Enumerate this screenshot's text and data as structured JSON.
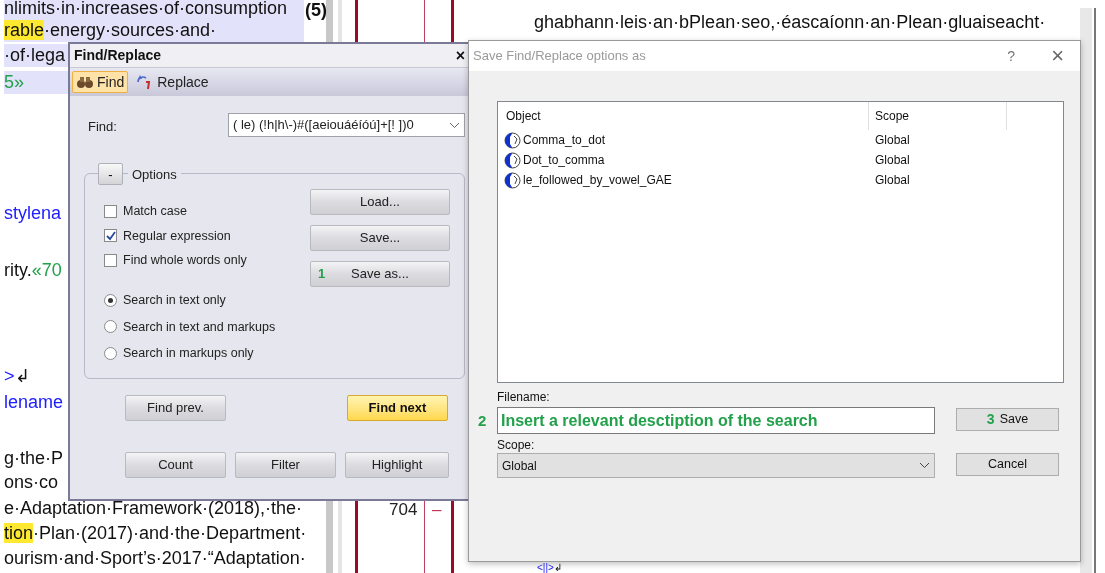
{
  "document_left": {
    "heading_fragment": "(5)",
    "lines": [
      {
        "selected": true,
        "segments": [
          {
            "text": "nlimits·in·increases·of·consumption",
            "kind": "text",
            "highlighted": false
          }
        ]
      },
      {
        "selected": true,
        "segments": [
          {
            "text": "rable",
            "kind": "text",
            "highlighted": true
          },
          {
            "text": "·energy·sources·and·",
            "kind": "text",
            "highlighted": false
          }
        ]
      },
      {
        "selected": true,
        "segments": [
          {
            "text": "·of·lega",
            "kind": "text",
            "highlighted": false
          }
        ]
      },
      {
        "selected": true,
        "segments": [
          {
            "text": "5»",
            "kind": "marker",
            "highlighted": false
          }
        ]
      },
      {
        "selected": false,
        "segments": [
          {
            "text": "stylena",
            "kind": "markup",
            "highlighted": false
          }
        ]
      },
      {
        "selected": false,
        "segments": [
          {
            "text": "rity.",
            "kind": "text",
            "highlighted": false
          },
          {
            "text": "«70",
            "kind": "marker",
            "highlighted": false
          }
        ]
      },
      {
        "selected": false,
        "segments": [
          {
            "text": ">",
            "kind": "markup",
            "highlighted": false
          },
          {
            "text": "↲",
            "kind": "text",
            "highlighted": false
          }
        ]
      },
      {
        "selected": false,
        "segments": [
          {
            "text": "lename",
            "kind": "markup",
            "highlighted": false
          }
        ]
      },
      {
        "selected": false,
        "segments": [
          {
            "text": "g·the·P",
            "kind": "text",
            "highlighted": false
          }
        ]
      },
      {
        "selected": false,
        "segments": [
          {
            "text": "ons·co",
            "kind": "text",
            "highlighted": false
          }
        ]
      },
      {
        "selected": false,
        "segments": [
          {
            "text": "e·Adaptation·Framework·(2018),·the·",
            "kind": "text",
            "highlighted": false
          }
        ]
      },
      {
        "selected": false,
        "segments": [
          {
            "text": "tion",
            "kind": "text",
            "highlighted": true
          },
          {
            "text": "·Plan·(2017)·and·the·Department·",
            "kind": "text",
            "highlighted": false
          }
        ]
      },
      {
        "selected": false,
        "segments": [
          {
            "text": "ourism·and·Sport’s·2017·“Adaptation·",
            "kind": "text",
            "highlighted": false
          }
        ]
      }
    ]
  },
  "margin": {
    "line_number": "704",
    "change_mark": "–"
  },
  "document_right": {
    "lines": [
      {
        "segments": [
          {
            "text": "ghabhann·leis·an·bPlean·seo,·éascaíonn·an·Plean·gluaiseacht·",
            "kind": "text"
          }
        ]
      },
      {
        "segments": [
          {
            "text": "<||>",
            "kind": "markup"
          },
          {
            "text": "↲",
            "kind": "text"
          }
        ]
      }
    ]
  },
  "find_dialog": {
    "title": "Find/Replace",
    "close": "×",
    "tabs": [
      {
        "label": "Find",
        "selected": true,
        "kind": "find"
      },
      {
        "label": "Replace",
        "selected": false,
        "kind": "replace"
      }
    ],
    "find_label": "Find:",
    "find_value": "( le) (!h|h\\-)#([aeiouáéíóú]+[! ])0",
    "options": {
      "toggle": "-",
      "label": "Options",
      "checkboxes": [
        {
          "label": "Match case",
          "checked": false
        },
        {
          "label": "Regular expression",
          "checked": true
        },
        {
          "label": "Find whole words only",
          "checked": false
        }
      ],
      "radios": [
        {
          "label": "Search in text only",
          "selected": true
        },
        {
          "label": "Search in text and markups",
          "selected": false
        },
        {
          "label": "Search in markups only",
          "selected": false
        }
      ],
      "buttons": [
        {
          "label": "Load..."
        },
        {
          "label": "Save..."
        },
        {
          "label": "Save as...",
          "step": "1"
        }
      ]
    },
    "find_buttons": [
      {
        "label": "Find prev.",
        "default": false
      },
      {
        "label": "Find next",
        "default": true
      }
    ],
    "bottom_buttons": [
      "Count",
      "Filter",
      "Highlight"
    ]
  },
  "save_dialog": {
    "title": "Save Find/Replace options as",
    "help": "?",
    "close": "×",
    "columns": [
      "Object",
      "Scope"
    ],
    "rows": [
      {
        "object": "Comma_to_dot",
        "scope": "Global"
      },
      {
        "object": "Dot_to_comma",
        "scope": "Global"
      },
      {
        "object": "le_followed_by_vowel_GAE",
        "scope": "Global"
      }
    ],
    "filename_label": "Filename:",
    "filename_step": "2",
    "filename_value": "Insert a relevant desctiption of the search",
    "scope_label": "Scope:",
    "scope_value": "Global",
    "buttons": [
      {
        "label": "Save",
        "step": "3"
      },
      {
        "label": "Cancel"
      }
    ]
  }
}
